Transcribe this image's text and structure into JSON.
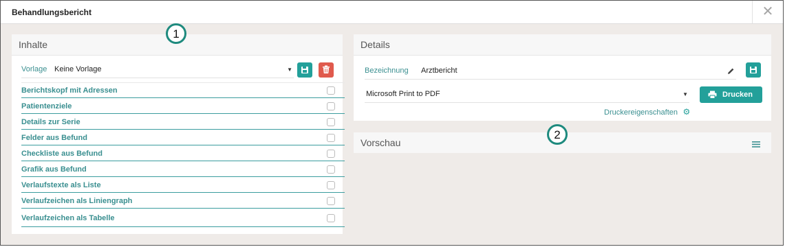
{
  "window": {
    "title": "Behandlungsbericht",
    "close_glyph": "✕"
  },
  "inhalte": {
    "header": "Inhalte",
    "vorlage_label": "Vorlage",
    "vorlage_value": "Keine Vorlage",
    "items": [
      {
        "label": "Berichtskopf mit Adressen",
        "checked": false
      },
      {
        "label": "Patientenziele",
        "checked": false
      },
      {
        "label": "Details zur Serie",
        "checked": false
      },
      {
        "label": "Felder aus Befund",
        "checked": false
      },
      {
        "label": "Checkliste aus Befund",
        "checked": false
      },
      {
        "label": "Grafik aus Befund",
        "checked": false
      },
      {
        "label": "Verlaufstexte als Liste",
        "checked": false
      },
      {
        "label": "Verlaufzeichen als Liniengraph",
        "checked": false
      },
      {
        "label": "Verlaufzeichen als Tabelle",
        "checked": false
      }
    ]
  },
  "details": {
    "header": "Details",
    "bezeichnung_label": "Bezeichnung",
    "bezeichnung_value": "Arztbericht",
    "printer_value": "Microsoft Print to PDF",
    "print_button": "Drucken",
    "printer_properties": "Druckereigenschaften"
  },
  "vorschau": {
    "header": "Vorschau"
  },
  "callouts": {
    "one": "1",
    "two": "2"
  },
  "colors": {
    "accent": "#23a09a",
    "danger": "#e05a4d",
    "link": "#3a8f90"
  }
}
